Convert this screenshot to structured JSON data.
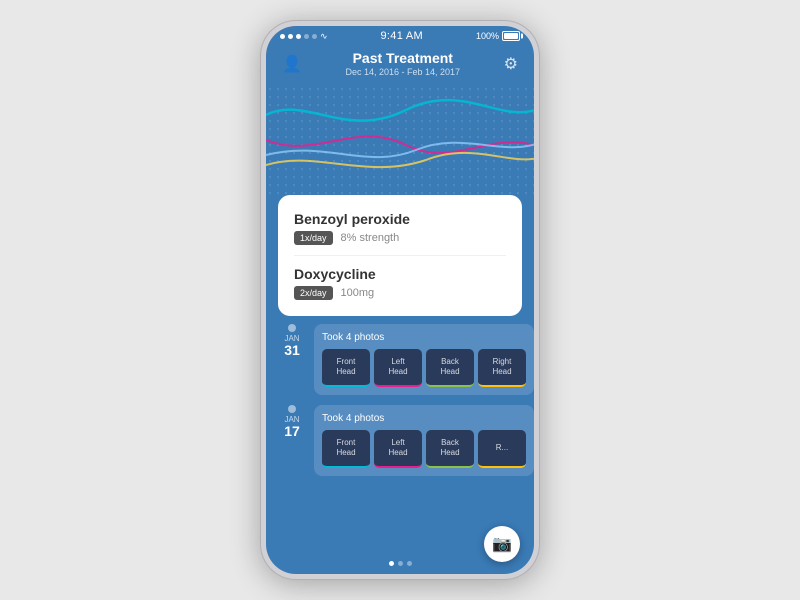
{
  "statusBar": {
    "time": "9:41 AM",
    "batteryPercent": "100%"
  },
  "header": {
    "title": "Past Treatment",
    "dateRange": "Dec 14, 2016 - Feb 14, 2017"
  },
  "medications": [
    {
      "name": "Benzoyl peroxide",
      "frequency": "1x/day",
      "detail": "8% strength"
    },
    {
      "name": "Doxycycline",
      "frequency": "2x/day",
      "detail": "100mg"
    }
  ],
  "timeline": [
    {
      "month": "JAN",
      "day": "31",
      "photoCount": "Took 4 photos",
      "photos": [
        {
          "label": "Front\nHead",
          "color": "teal"
        },
        {
          "label": "Left\nHead",
          "color": "pink"
        },
        {
          "label": "Back\nHead",
          "color": "green"
        },
        {
          "label": "Right\nHead",
          "color": "yellow"
        }
      ]
    },
    {
      "month": "JAN",
      "day": "17",
      "photoCount": "Took 4 photos",
      "photos": [
        {
          "label": "Front\nHead",
          "color": "teal"
        },
        {
          "label": "Left\nHead",
          "color": "pink"
        },
        {
          "label": "Back\nHead",
          "color": "green"
        },
        {
          "label": "R...",
          "color": "yellow"
        }
      ]
    }
  ],
  "navDots": [
    "active",
    "inactive",
    "inactive"
  ],
  "icons": {
    "person": "👤",
    "gear": "⚙️",
    "camera": "📷"
  }
}
